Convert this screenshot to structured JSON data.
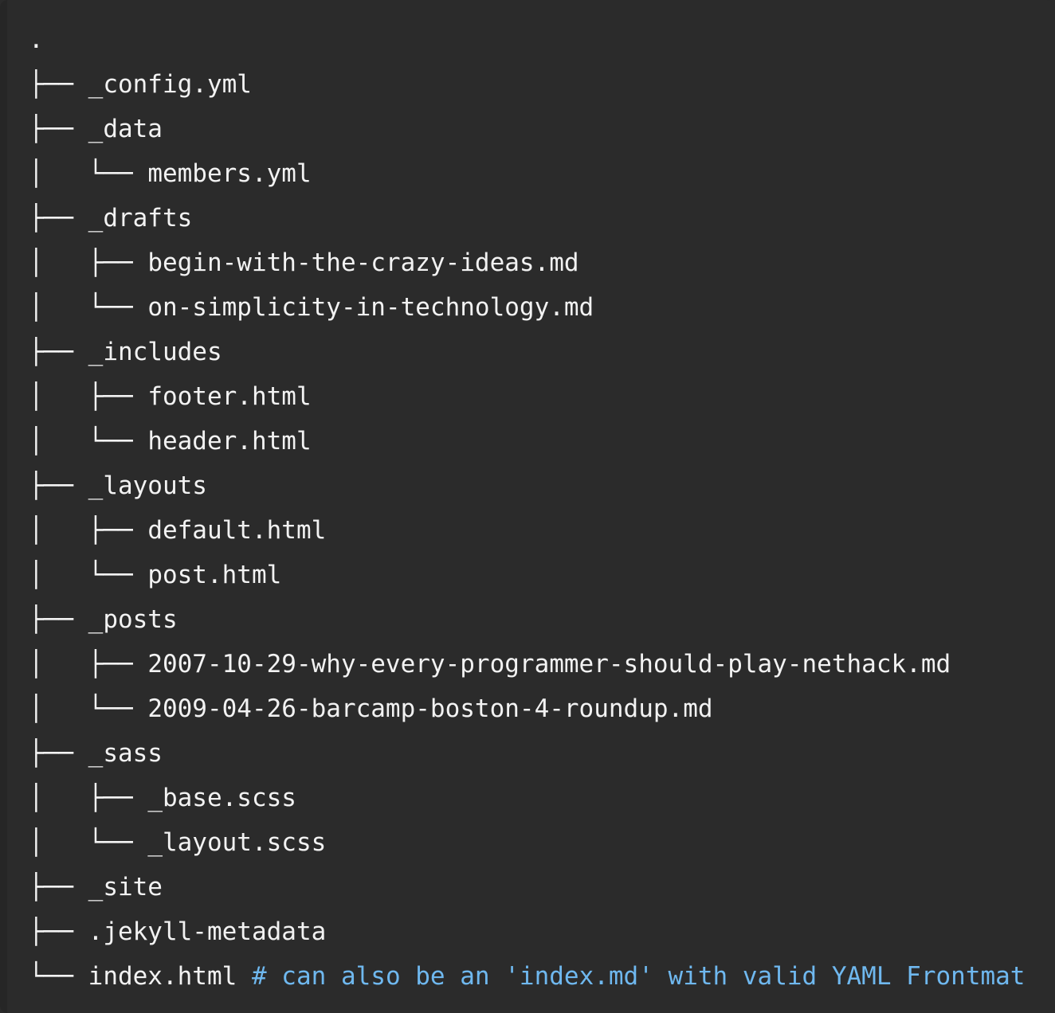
{
  "block": {
    "type": "terminal-directory-tree",
    "background_color": "#2b2b2b",
    "text_color": "#f2f2f2",
    "comment_color": "#6fb8ef",
    "gutter_color": "#262626",
    "font": "monospace",
    "truncated_right_edge": true
  },
  "tree": {
    "root_label": ".",
    "lines": [
      {
        "prefix": "",
        "name": ".",
        "comment": ""
      },
      {
        "prefix": "├── ",
        "name": "_config.yml",
        "comment": ""
      },
      {
        "prefix": "├── ",
        "name": "_data",
        "comment": ""
      },
      {
        "prefix": "│   └── ",
        "name": "members.yml",
        "comment": ""
      },
      {
        "prefix": "├── ",
        "name": "_drafts",
        "comment": ""
      },
      {
        "prefix": "│   ├── ",
        "name": "begin-with-the-crazy-ideas.md",
        "comment": ""
      },
      {
        "prefix": "│   └── ",
        "name": "on-simplicity-in-technology.md",
        "comment": ""
      },
      {
        "prefix": "├── ",
        "name": "_includes",
        "comment": ""
      },
      {
        "prefix": "│   ├── ",
        "name": "footer.html",
        "comment": ""
      },
      {
        "prefix": "│   └── ",
        "name": "header.html",
        "comment": ""
      },
      {
        "prefix": "├── ",
        "name": "_layouts",
        "comment": ""
      },
      {
        "prefix": "│   ├── ",
        "name": "default.html",
        "comment": ""
      },
      {
        "prefix": "│   └── ",
        "name": "post.html",
        "comment": ""
      },
      {
        "prefix": "├── ",
        "name": "_posts",
        "comment": ""
      },
      {
        "prefix": "│   ├── ",
        "name": "2007-10-29-why-every-programmer-should-play-nethack.md",
        "comment": ""
      },
      {
        "prefix": "│   └── ",
        "name": "2009-04-26-barcamp-boston-4-roundup.md",
        "comment": ""
      },
      {
        "prefix": "├── ",
        "name": "_sass",
        "comment": ""
      },
      {
        "prefix": "│   ├── ",
        "name": "_base.scss",
        "comment": ""
      },
      {
        "prefix": "│   └── ",
        "name": "_layout.scss",
        "comment": ""
      },
      {
        "prefix": "├── ",
        "name": "_site",
        "comment": ""
      },
      {
        "prefix": "├── ",
        "name": ".jekyll-metadata",
        "comment": ""
      },
      {
        "prefix": "└── ",
        "name": "index.html ",
        "comment": "# can also be an 'index.md' with valid YAML Frontmat"
      }
    ]
  }
}
